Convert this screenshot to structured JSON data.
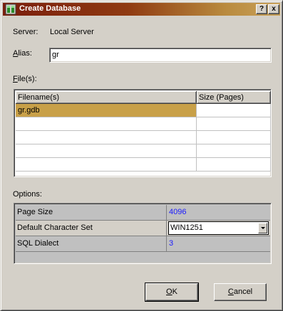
{
  "window": {
    "title": "Create Database",
    "help_glyph": "?",
    "close_glyph": "x",
    "icon": "database-app-icon"
  },
  "server": {
    "label": "Server:",
    "value": "Local Server"
  },
  "alias": {
    "label_accel": "A",
    "label_rest": "lias:",
    "value": "gr"
  },
  "files": {
    "label_accel": "F",
    "label_rest": "ile(s):",
    "columns": [
      "Filename(s)",
      "Size (Pages)"
    ],
    "rows": [
      [
        "gr.gdb",
        ""
      ],
      [
        "",
        ""
      ],
      [
        "",
        ""
      ],
      [
        "",
        ""
      ],
      [
        "",
        ""
      ]
    ]
  },
  "options": {
    "label": "Options:",
    "rows": [
      {
        "label": "Page Size",
        "value": "4096"
      },
      {
        "label": "Default Character Set",
        "value": "WIN1251"
      },
      {
        "label": "SQL Dialect",
        "value": "3"
      }
    ]
  },
  "buttons": {
    "ok_accel": "O",
    "ok_rest": "K",
    "cancel_pre": "",
    "cancel_accel": "C",
    "cancel_rest": "ancel"
  },
  "colors": {
    "selection": "#c8a048",
    "value_text": "#1a1aff",
    "title_gradient_start": "#7a1e0c",
    "title_gradient_end": "#c9a25a"
  }
}
